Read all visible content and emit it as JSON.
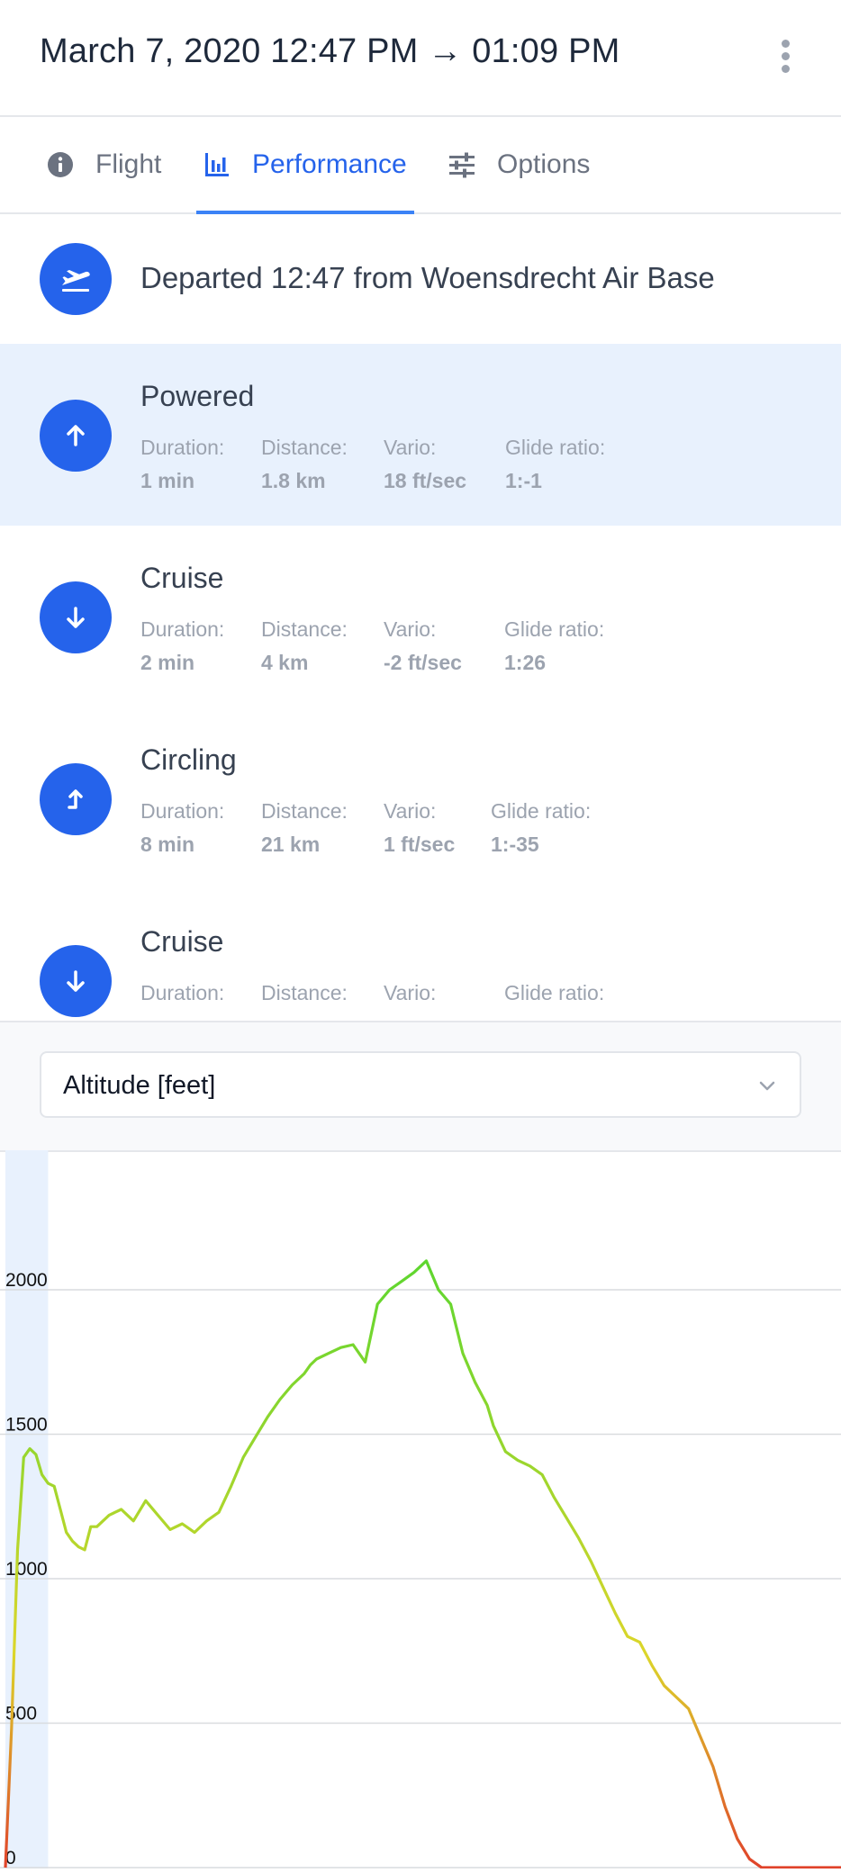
{
  "header": {
    "title": "March 7, 2020 12:47 PM → 01:09 PM",
    "menu_icon": "kebab-menu-icon"
  },
  "tabs": [
    {
      "label": "Flight",
      "icon": "info-icon",
      "active": false
    },
    {
      "label": "Performance",
      "icon": "bar-chart-icon",
      "active": true
    },
    {
      "label": "Options",
      "icon": "sliders-icon",
      "active": false
    }
  ],
  "departure": {
    "text": "Departed 12:47 from Woensdrecht Air Base",
    "icon": "takeoff-icon"
  },
  "phases": [
    {
      "name": "Powered",
      "icon": "arrow-up-icon",
      "selected": true,
      "duration_label": "Duration:",
      "duration": "1 min",
      "distance_label": "Distance:",
      "distance": "1.8 km",
      "vario_label": "Vario:",
      "vario": "18 ft/sec",
      "glide_label": "Glide ratio:",
      "glide": "1:-1"
    },
    {
      "name": "Cruise",
      "icon": "arrow-down-icon",
      "selected": false,
      "duration_label": "Duration:",
      "duration": "2 min",
      "distance_label": "Distance:",
      "distance": "4 km",
      "vario_label": "Vario:",
      "vario": "-2 ft/sec",
      "glide_label": "Glide ratio:",
      "glide": "1:26"
    },
    {
      "name": "Circling",
      "icon": "turn-up-icon",
      "selected": false,
      "duration_label": "Duration:",
      "duration": "8 min",
      "distance_label": "Distance:",
      "distance": "21 km",
      "vario_label": "Vario:",
      "vario": "1 ft/sec",
      "glide_label": "Glide ratio:",
      "glide": "1:-35"
    },
    {
      "name": "Cruise",
      "icon": "arrow-down-icon",
      "selected": false,
      "duration_label": "Duration:",
      "duration": "",
      "distance_label": "Distance:",
      "distance": "",
      "vario_label": "Vario:",
      "vario": "",
      "glide_label": "Glide ratio:",
      "glide": ""
    }
  ],
  "selector": {
    "value": "Altitude [feet]",
    "icon": "chevron-down-icon"
  },
  "colors": {
    "accent": "#2563eb",
    "selected_row": "#e8f1fd",
    "line_high": "#4cd630",
    "line_mid": "#dcd62a",
    "line_low": "#e0412a"
  },
  "chart_data": {
    "type": "line",
    "title": "",
    "xlabel": "",
    "ylabel": "",
    "ylim": [
      0,
      2500
    ],
    "yticks": [
      "0",
      "500",
      "1000",
      "1500",
      "2000"
    ],
    "grid": true,
    "highlight_band": [
      0,
      14
    ],
    "x": [
      0,
      2,
      4,
      6,
      8,
      10,
      12,
      14,
      16,
      18,
      20,
      22,
      24,
      26,
      28,
      30,
      34,
      38,
      42,
      46,
      50,
      54,
      58,
      62,
      66,
      70,
      74,
      78,
      82,
      86,
      90,
      94,
      98,
      100,
      102,
      106,
      110,
      114,
      118,
      122,
      126,
      130,
      134,
      138,
      142,
      146,
      150,
      154,
      156,
      158,
      160,
      164,
      168,
      172,
      176,
      180,
      184,
      188,
      192,
      196,
      200,
      204,
      208,
      212,
      216,
      220,
      224,
      228,
      232,
      236,
      240,
      244,
      248,
      252,
      256,
      258,
      260,
      262,
      264,
      266,
      268,
      270,
      272,
      274
    ],
    "series": [
      {
        "values": [
          0,
          480,
          1100,
          1420,
          1450,
          1430,
          1360,
          1330,
          1320,
          1240,
          1160,
          1130,
          1110,
          1100,
          1180,
          1180,
          1220,
          1240,
          1200,
          1270,
          1220,
          1170,
          1190,
          1160,
          1200,
          1230,
          1320,
          1420,
          1490,
          1560,
          1620,
          1670,
          1710,
          1740,
          1760,
          1780,
          1800,
          1810,
          1750,
          1950,
          2000,
          2030,
          2060,
          2100,
          2000,
          1950,
          1780,
          1680,
          1640,
          1600,
          1530,
          1440,
          1410,
          1390,
          1360,
          1280,
          1210,
          1140,
          1060,
          970,
          880,
          800,
          780,
          700,
          630,
          590,
          550,
          450,
          350,
          210,
          100,
          30,
          0,
          0,
          0,
          0,
          0,
          0,
          0,
          0,
          0,
          0,
          0,
          0
        ]
      }
    ]
  }
}
